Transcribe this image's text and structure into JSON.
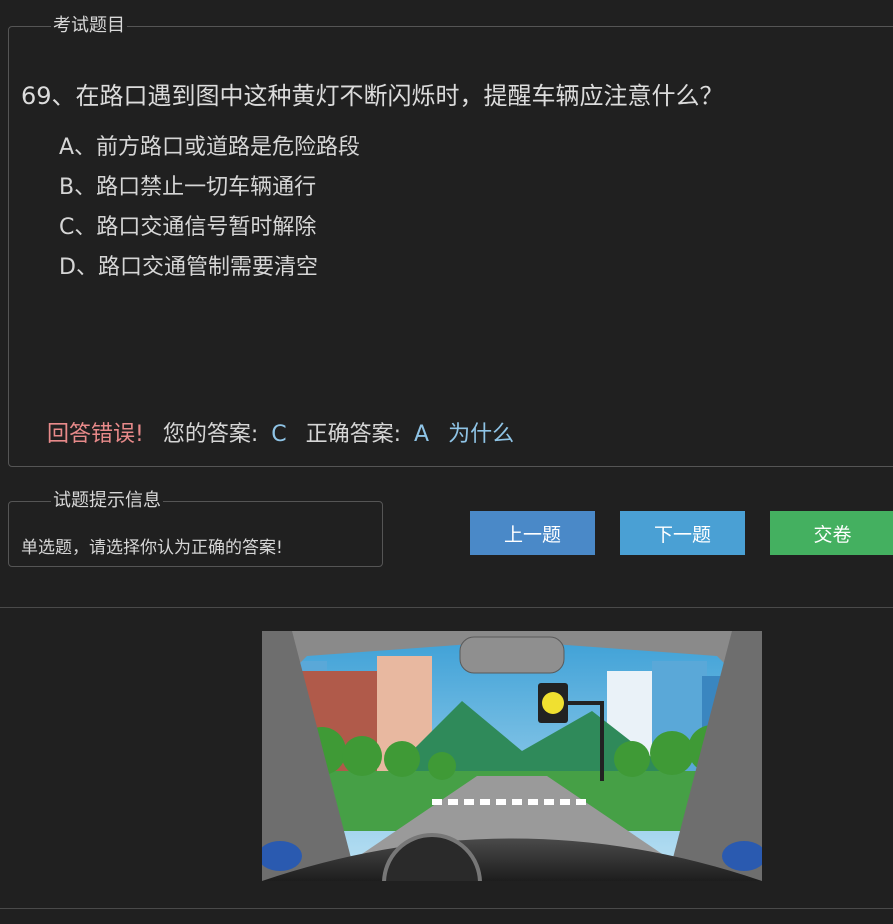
{
  "question_box": {
    "legend": "考试题目",
    "question": "69、在路口遇到图中这种黄灯不断闪烁时，提醒车辆应注意什么？",
    "options": [
      "A、前方路口或道路是危险路段",
      "B、路口禁止一切车辆通行",
      "C、路口交通信号暂时解除",
      "D、路口交通管制需要清空"
    ],
    "result": {
      "status": "回答错误!",
      "your_label": "您的答案:",
      "your_answer": "C",
      "correct_label": "正确答案:",
      "correct_answer": "A",
      "why": "为什么"
    }
  },
  "hint_box": {
    "legend": "试题提示信息",
    "text": "单选题，请选择你认为正确的答案!"
  },
  "buttons": {
    "prev": "上一题",
    "next": "下一题",
    "submit": "交卷"
  },
  "image": {
    "subject": "yellow-flashing-traffic-light-intersection",
    "light_color": "#f0e030"
  }
}
